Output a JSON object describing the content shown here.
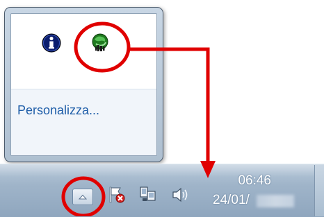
{
  "flyout": {
    "icons": [
      "info-icon",
      "green-tray-app-icon"
    ],
    "customize_link": "Personalizza..."
  },
  "taskbar": {
    "show_hidden_button_icon": "chevron-up-icon",
    "tray_icons": [
      "action-center-flag-icon",
      "network-icon",
      "volume-icon"
    ],
    "clock": {
      "time": "06:46",
      "date": "24/01/"
    }
  },
  "annotation": {
    "color": "#e00000"
  }
}
